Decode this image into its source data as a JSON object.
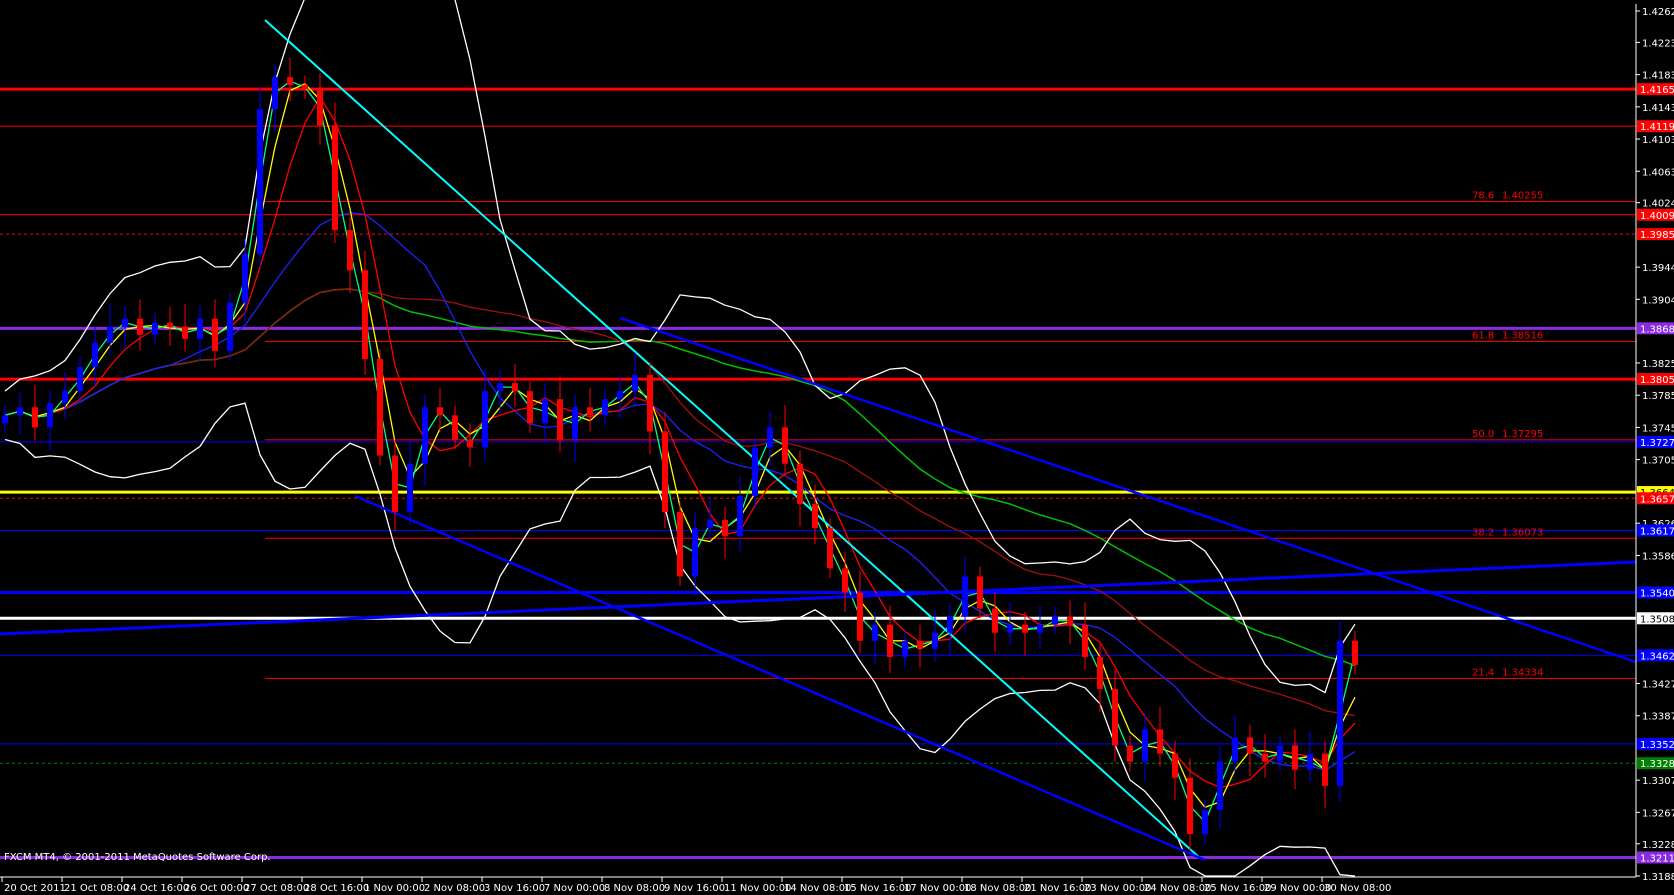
{
  "window": {
    "copyright": "FXCM MT4, © 2001-2011 MetaQuotes Software Corp."
  },
  "colors": {
    "background": "#000000",
    "bull": "#0000ff",
    "bear": "#ff0000",
    "axis": "#ffffff",
    "fib": "#ff0000"
  },
  "chart_data": {
    "type": "candlestick",
    "title": "",
    "ylim": [
      1.3188,
      1.4262
    ],
    "price_ticks": [
      "1.42620",
      "1.42230",
      "1.41830",
      "1.41430",
      "1.41030",
      "1.40630",
      "1.40240",
      "1.39440",
      "1.39040",
      "1.38250",
      "1.37850",
      "1.37450",
      "1.37050",
      "1.36260",
      "1.35860",
      "1.34270",
      "1.33870",
      "1.33070",
      "1.32670",
      "1.32280",
      "1.31880"
    ],
    "time_labels": [
      "20 Oct 2011",
      "21 Oct 08:00",
      "24 Oct 16:00",
      "26 Oct 00:00",
      "27 Oct 08:00",
      "28 Oct 16:00",
      "1 Nov 00:00",
      "2 Nov 08:00",
      "3 Nov 16:00",
      "7 Nov 00:00",
      "8 Nov 08:00",
      "9 Nov 16:00",
      "11 Nov 00:00",
      "14 Nov 08:00",
      "15 Nov 16:00",
      "17 Nov 00:00",
      "18 Nov 08:00",
      "21 Nov 16:00",
      "23 Nov 00:00",
      "24 Nov 08:00",
      "25 Nov 16:00",
      "29 Nov 00:00",
      "30 Nov 08:00"
    ],
    "closes": [
      1.376,
      1.377,
      1.3745,
      1.3775,
      1.379,
      1.382,
      1.385,
      1.387,
      1.388,
      1.386,
      1.3875,
      1.387,
      1.3855,
      1.388,
      1.384,
      1.39,
      1.396,
      1.414,
      1.418,
      1.417,
      1.4165,
      1.412,
      1.399,
      1.394,
      1.383,
      1.371,
      1.364,
      1.37,
      1.377,
      1.376,
      1.373,
      1.372,
      1.379,
      1.38,
      1.379,
      1.375,
      1.378,
      1.373,
      1.377,
      1.376,
      1.378,
      1.379,
      1.381,
      1.374,
      1.364,
      1.356,
      1.362,
      1.363,
      1.361,
      1.366,
      1.372,
      1.3745,
      1.37,
      1.365,
      1.362,
      1.357,
      1.354,
      1.348,
      1.35,
      1.346,
      1.348,
      1.347,
      1.349,
      1.351,
      1.356,
      1.352,
      1.349,
      1.35,
      1.349,
      1.35,
      1.351,
      1.35,
      1.346,
      1.342,
      1.335,
      1.333,
      1.337,
      1.334,
      1.331,
      1.324,
      1.327,
      1.333,
      1.336,
      1.334,
      1.333,
      1.335,
      1.332,
      1.334,
      1.33,
      1.348,
      1.345
    ],
    "levels": [
      {
        "price": 1.4165,
        "label": "1.41650",
        "color": "#ff0000",
        "style": "thick"
      },
      {
        "price": 1.4119,
        "label": "1.41190",
        "color": "#ff0000",
        "style": "thin"
      },
      {
        "price": 1.4009,
        "label": "1.40090",
        "color": "#ff0000",
        "style": "thin"
      },
      {
        "price": 1.3985,
        "label": "1.39850",
        "color": "#ff0000",
        "style": "dashed"
      },
      {
        "price": 1.3868,
        "label": "1.38680",
        "color": "#8a2be2",
        "style": "thick"
      },
      {
        "price": 1.3805,
        "label": "1.38050",
        "color": "#ff0000",
        "style": "thick"
      },
      {
        "price": 1.3727,
        "label": "1.37270",
        "color": "#0000ff",
        "style": "thin"
      },
      {
        "price": 1.36647,
        "label": "1.36647",
        "color": "#ffff00",
        "style": "thick"
      },
      {
        "price": 1.3657,
        "label": "1.36570",
        "color": "#ff0000",
        "style": "dashed"
      },
      {
        "price": 1.3617,
        "label": "1.36170",
        "color": "#0000ff",
        "style": "thin"
      },
      {
        "price": 1.354,
        "label": "1.35400",
        "color": "#0000ff",
        "style": "thick"
      },
      {
        "price": 1.3508,
        "label": "1.35080",
        "color": "#ffffff",
        "style": "thick"
      },
      {
        "price": 1.3462,
        "label": "1.34620",
        "color": "#0000ff",
        "style": "thin"
      },
      {
        "price": 1.3352,
        "label": "1.33520",
        "color": "#0000ff",
        "style": "thin"
      },
      {
        "price": 1.3328,
        "label": "1.33280",
        "color": "#008000",
        "style": "dashed"
      },
      {
        "price": 1.3211,
        "label": "1.32110",
        "color": "#8a2be2",
        "style": "thick"
      }
    ],
    "fibonacci": [
      {
        "ratio": "78.6",
        "price": 1.40255,
        "label": "1.40255"
      },
      {
        "ratio": "61.8",
        "price": 1.38516,
        "label": "1.38516"
      },
      {
        "ratio": "50.0",
        "price": 1.37295,
        "label": "1.37295"
      },
      {
        "ratio": "38.2",
        "price": 1.36073,
        "label": "1.36073"
      },
      {
        "ratio": "21.4",
        "price": 1.34334,
        "label": "1.34334"
      }
    ]
  }
}
